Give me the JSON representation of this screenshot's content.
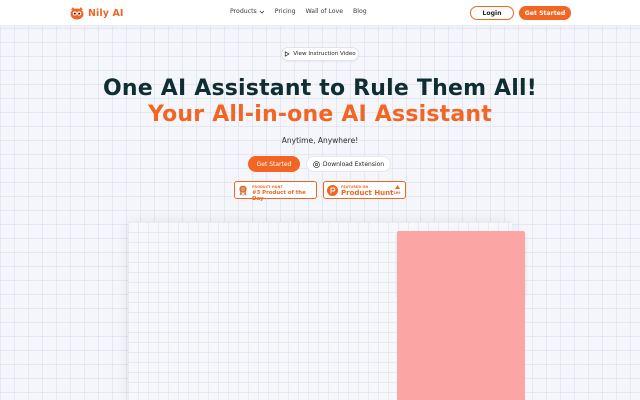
{
  "header": {
    "brand": "Nily AI",
    "nav": [
      {
        "label": "Products",
        "has_dropdown": true
      },
      {
        "label": "Pricing"
      },
      {
        "label": "Wall of Love"
      },
      {
        "label": "Blog"
      }
    ],
    "login_label": "Login",
    "get_started_label": "Get Started"
  },
  "hero": {
    "video_label": "View Instruction Video",
    "title_line1": "One AI Assistant to Rule Them All!",
    "title_line2": "Your All-in-one AI Assistant",
    "tagline": "Anytime, Anywhere!",
    "primary_cta": "Get Started",
    "secondary_cta": "Download Extension"
  },
  "badges": {
    "potd": {
      "small": "PRODUCT HUNT",
      "big": "#3 Product of the Day"
    },
    "ph": {
      "small": "FEATURED ON",
      "big": "Product Hunt",
      "upvotes": "169"
    }
  },
  "colors": {
    "accent": "#f26522",
    "heading": "#0f2e33",
    "panel": "#fca5a5",
    "background": "#f4f6fb"
  },
  "icons": {
    "logo": "owl-logo-icon",
    "dropdown": "chevron-down-icon",
    "video": "play-icon",
    "extension": "chrome-icon",
    "award": "medal-icon",
    "producthunt": "producthunt-logo-icon",
    "upvote": "triangle-up-icon"
  }
}
